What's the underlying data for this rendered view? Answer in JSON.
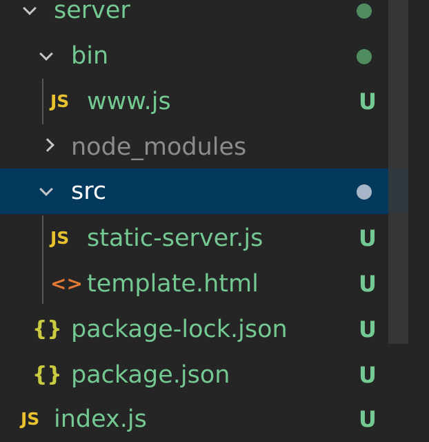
{
  "explorer": {
    "items": [
      {
        "label": "server",
        "type": "folder",
        "expanded": true,
        "indent": 0,
        "status": "modified-dot",
        "icon": "chevron-down-icon"
      },
      {
        "label": "bin",
        "type": "folder",
        "expanded": true,
        "indent": 1,
        "status": "modified-dot",
        "icon": "chevron-down-icon"
      },
      {
        "label": "www.js",
        "type": "file",
        "file_icon": "JS",
        "indent": 2,
        "status": "U",
        "icon": "javascript-file-icon"
      },
      {
        "label": "node_modules",
        "type": "folder",
        "expanded": false,
        "indent": 1,
        "status": "",
        "icon": "chevron-right-icon"
      },
      {
        "label": "src",
        "type": "folder",
        "expanded": true,
        "indent": 1,
        "status": "modified-dot",
        "selected": true,
        "icon": "chevron-down-icon"
      },
      {
        "label": "static-server.js",
        "type": "file",
        "file_icon": "JS",
        "indent": 2,
        "status": "U",
        "icon": "javascript-file-icon"
      },
      {
        "label": "template.html",
        "type": "file",
        "file_icon": "<>",
        "indent": 2,
        "status": "U",
        "icon": "html-file-icon"
      },
      {
        "label": "package-lock.json",
        "type": "file",
        "file_icon": "{}",
        "indent": 1,
        "status": "U",
        "icon": "json-file-icon"
      },
      {
        "label": "package.json",
        "type": "file",
        "file_icon": "{}",
        "indent": 1,
        "status": "U",
        "icon": "json-file-icon"
      },
      {
        "label": "index.js",
        "type": "file",
        "file_icon": "JS",
        "indent": 0,
        "status": "U",
        "icon": "javascript-file-icon"
      }
    ]
  },
  "colors": {
    "background": "#252526",
    "selected_row": "#04395e",
    "untracked_green": "#73c991",
    "ignored_grey": "#8c8c8c",
    "js_icon": "#e8c22f",
    "html_icon": "#e37933",
    "json_icon": "#cbcb41"
  }
}
